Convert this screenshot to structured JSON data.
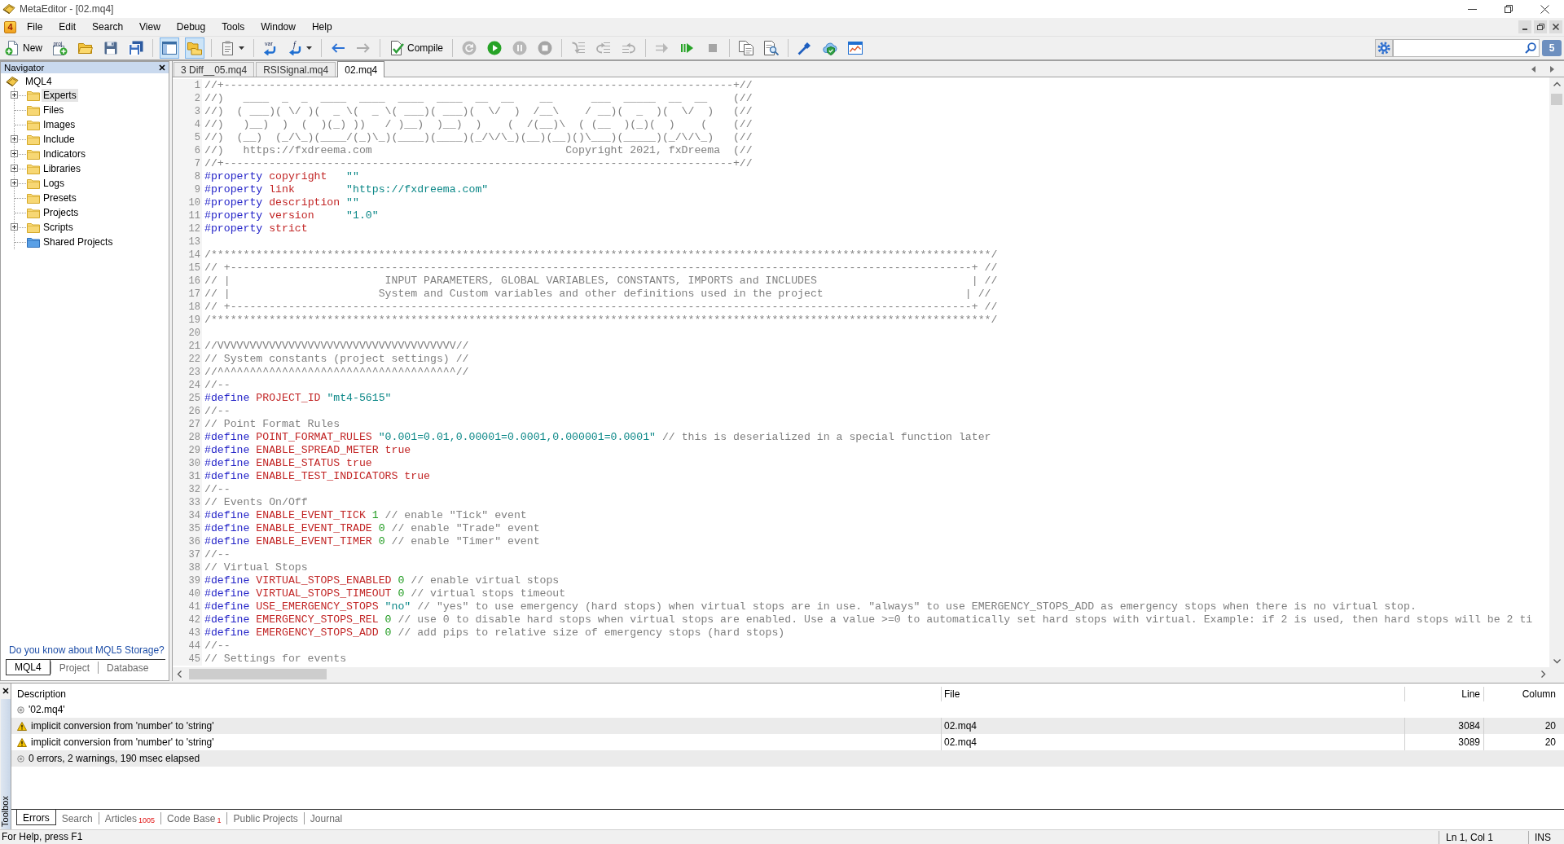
{
  "window": {
    "title": "MetaEditor - [02.mq4]"
  },
  "menu_bar": {
    "badge": "4",
    "items": [
      "File",
      "Edit",
      "Search",
      "View",
      "Debug",
      "Tools",
      "Window",
      "Help"
    ]
  },
  "toolbar": {
    "groups": [
      [
        {
          "label": "New",
          "pressed": false,
          "disabled": false,
          "dropdown": false
        },
        {
          "glyph": "proj",
          "pressed": false,
          "disabled": false,
          "dropdown": false
        },
        {
          "pressed": false,
          "disabled": false,
          "dropdown": false
        },
        {
          "pressed": false,
          "disabled": false,
          "dropdown": false
        },
        {
          "pressed": false,
          "disabled": false,
          "dropdown": false
        }
      ],
      [
        {
          "pressed": true,
          "disabled": false,
          "dropdown": false
        },
        {
          "pressed": true,
          "disabled": false,
          "dropdown": false
        }
      ],
      [
        {
          "pressed": false,
          "disabled": false,
          "dropdown": true
        }
      ],
      [
        {
          "glyph": "var",
          "pressed": false,
          "disabled": false,
          "dropdown": false
        },
        {
          "glyph": "f",
          "pressed": false,
          "disabled": false,
          "dropdown": true
        }
      ],
      [
        {
          "pressed": false,
          "disabled": false,
          "dropdown": false
        },
        {
          "pressed": false,
          "disabled": true,
          "dropdown": false
        }
      ],
      [
        {
          "label": "Compile",
          "pressed": false,
          "disabled": false,
          "dropdown": false
        }
      ],
      [
        {
          "pressed": false,
          "disabled": true,
          "dropdown": false
        },
        {
          "pressed": false,
          "disabled": false,
          "dropdown": false
        },
        {
          "pressed": false,
          "disabled": true,
          "dropdown": false
        },
        {
          "pressed": false,
          "disabled": true,
          "dropdown": false
        }
      ],
      [
        {
          "pressed": false,
          "disabled": true,
          "dropdown": false
        },
        {
          "pressed": false,
          "disabled": true,
          "dropdown": false
        },
        {
          "pressed": false,
          "disabled": true,
          "dropdown": false
        }
      ],
      [
        {
          "pressed": false,
          "disabled": true,
          "dropdown": false
        },
        {
          "pressed": false,
          "disabled": false,
          "dropdown": false
        },
        {
          "pressed": false,
          "disabled": true,
          "dropdown": false
        }
      ],
      [
        {
          "pressed": false,
          "disabled": false,
          "dropdown": false
        },
        {
          "pressed": false,
          "disabled": false,
          "dropdown": false
        }
      ],
      [
        {
          "pressed": false,
          "disabled": false,
          "dropdown": false
        },
        {
          "pressed": false,
          "disabled": false,
          "dropdown": false
        },
        {
          "pressed": false,
          "disabled": false,
          "dropdown": false
        }
      ]
    ],
    "chat_count": "5"
  },
  "navigator": {
    "title": "Navigator",
    "root": {
      "label": "MQL4",
      "selected": false,
      "children": [
        {
          "label": "Experts",
          "kind": "folder",
          "expandable": true,
          "selected": true
        },
        {
          "label": "Files",
          "kind": "folder",
          "expandable": false,
          "selected": false
        },
        {
          "label": "Images",
          "kind": "folder",
          "expandable": false,
          "selected": false
        },
        {
          "label": "Include",
          "kind": "folder",
          "expandable": true,
          "selected": false
        },
        {
          "label": "Indicators",
          "kind": "folder",
          "expandable": true,
          "selected": false
        },
        {
          "label": "Libraries",
          "kind": "folder",
          "expandable": true,
          "selected": false
        },
        {
          "label": "Logs",
          "kind": "folder",
          "expandable": true,
          "selected": false
        },
        {
          "label": "Presets",
          "kind": "folder",
          "expandable": false,
          "selected": false
        },
        {
          "label": "Projects",
          "kind": "folder",
          "expandable": false,
          "selected": false
        },
        {
          "label": "Scripts",
          "kind": "folder",
          "expandable": true,
          "selected": false
        },
        {
          "label": "Shared Projects",
          "kind": "shared",
          "expandable": false,
          "selected": false
        }
      ]
    },
    "storage_link": "Do you know about MQL5 Storage?",
    "tabs": [
      {
        "label": "MQL4",
        "selected": true
      },
      {
        "label": "Project",
        "selected": false
      },
      {
        "label": "Database",
        "selected": false
      }
    ]
  },
  "editor": {
    "tabs": [
      {
        "label": "3 Diff__05.mq4",
        "selected": false
      },
      {
        "label": "RSISignal.mq4",
        "selected": false
      },
      {
        "label": "02.mq4",
        "selected": true
      }
    ],
    "lines": [
      {
        "number": "1",
        "tokens": [
          {
            "kind": "comment",
            "text": "//+-------------------------------------------------------------------------------+//"
          }
        ]
      },
      {
        "number": "2",
        "tokens": [
          {
            "kind": "comment",
            "text": "//)   ____  _  _  ____  ____  ____  ____  __  __    __      ___  _____  __  __    (//"
          }
        ]
      },
      {
        "number": "3",
        "tokens": [
          {
            "kind": "comment",
            "text": "//)  ( ___)( \\/ )(  _ \\(  _ \\( ___)( ___)(  \\/  )  /__\\    / __)(  _  )(  \\/  )   (//"
          }
        ]
      },
      {
        "number": "4",
        "tokens": [
          {
            "kind": "comment",
            "text": "//)   )__)  )  (  )(_) ))   / )__)  )__)  )    (  /(__)\\  ( (__  )(_)(  )    (    (//"
          }
        ]
      },
      {
        "number": "5",
        "tokens": [
          {
            "kind": "comment",
            "text": "//)  (__)  (_/\\_)(____/(_)\\_)(____)(____)(_/\\/\\_)(__)(__)()\\___)(_____)(_/\\/\\_)   (//"
          }
        ]
      },
      {
        "number": "6",
        "tokens": [
          {
            "kind": "comment",
            "text": "//)   https://fxdreema.com                              Copyright 2021, fxDreema  (//"
          }
        ]
      },
      {
        "number": "7",
        "tokens": [
          {
            "kind": "comment",
            "text": "//+-------------------------------------------------------------------------------+//"
          }
        ]
      },
      {
        "number": "8",
        "tokens": [
          {
            "kind": "directive",
            "text": "#property"
          },
          {
            "kind": "name",
            "text": " copyright"
          },
          {
            "kind": "string",
            "text": "   \"\""
          }
        ]
      },
      {
        "number": "9",
        "tokens": [
          {
            "kind": "directive",
            "text": "#property"
          },
          {
            "kind": "name",
            "text": " link"
          },
          {
            "kind": "string",
            "text": "        \"https://fxdreema.com\""
          }
        ]
      },
      {
        "number": "10",
        "tokens": [
          {
            "kind": "directive",
            "text": "#property"
          },
          {
            "kind": "name",
            "text": " description"
          },
          {
            "kind": "string",
            "text": " \"\""
          }
        ]
      },
      {
        "number": "11",
        "tokens": [
          {
            "kind": "directive",
            "text": "#property"
          },
          {
            "kind": "name",
            "text": " version"
          },
          {
            "kind": "string",
            "text": "     \"1.0\""
          }
        ]
      },
      {
        "number": "12",
        "tokens": [
          {
            "kind": "directive",
            "text": "#property"
          },
          {
            "kind": "name",
            "text": " strict"
          }
        ]
      },
      {
        "number": "13"
      },
      {
        "number": "14",
        "tokens": [
          {
            "kind": "comment",
            "text": "/*************************************************************************************************************************/"
          }
        ]
      },
      {
        "number": "15",
        "tokens": [
          {
            "kind": "comment",
            "text": "// +-------------------------------------------------------------------------------------------------------------------+ //"
          }
        ]
      },
      {
        "number": "16",
        "tokens": [
          {
            "kind": "comment",
            "text": "// |                        INPUT PARAMETERS, GLOBAL VARIABLES, CONSTANTS, IMPORTS and INCLUDES                        | //"
          }
        ]
      },
      {
        "number": "17",
        "tokens": [
          {
            "kind": "comment",
            "text": "// |                       System and Custom variables and other definitions used in the project                      | //"
          }
        ]
      },
      {
        "number": "18",
        "tokens": [
          {
            "kind": "comment",
            "text": "// +-------------------------------------------------------------------------------------------------------------------+ //"
          }
        ]
      },
      {
        "number": "19",
        "tokens": [
          {
            "kind": "comment",
            "text": "/*************************************************************************************************************************/"
          }
        ]
      },
      {
        "number": "20"
      },
      {
        "number": "21",
        "tokens": [
          {
            "kind": "comment",
            "text": "//VVVVVVVVVVVVVVVVVVVVVVVVVVVVVVVVVVVVV//"
          }
        ]
      },
      {
        "number": "22",
        "tokens": [
          {
            "kind": "comment",
            "text": "// System constants (project settings) //"
          }
        ]
      },
      {
        "number": "23",
        "tokens": [
          {
            "kind": "comment",
            "text": "//^^^^^^^^^^^^^^^^^^^^^^^^^^^^^^^^^^^^^//"
          }
        ]
      },
      {
        "number": "24",
        "tokens": [
          {
            "kind": "comment",
            "text": "//--"
          }
        ]
      },
      {
        "number": "25",
        "tokens": [
          {
            "kind": "directive",
            "text": "#define"
          },
          {
            "kind": "name",
            "text": " PROJECT_ID"
          },
          {
            "kind": "string",
            "text": " \"mt4-5615\""
          }
        ]
      },
      {
        "number": "26",
        "tokens": [
          {
            "kind": "comment",
            "text": "//--"
          }
        ]
      },
      {
        "number": "27",
        "tokens": [
          {
            "kind": "comment",
            "text": "// Point Format Rules"
          }
        ]
      },
      {
        "number": "28",
        "tokens": [
          {
            "kind": "directive",
            "text": "#define"
          },
          {
            "kind": "name",
            "text": " POINT_FORMAT_RULES"
          },
          {
            "kind": "string",
            "text": " \"0.001=0.01,0.00001=0.0001,0.000001=0.0001\""
          },
          {
            "kind": "comment",
            "text": " // this is deserialized in a special function later"
          }
        ]
      },
      {
        "number": "29",
        "tokens": [
          {
            "kind": "directive",
            "text": "#define"
          },
          {
            "kind": "name",
            "text": " ENABLE_SPREAD_METER"
          },
          {
            "kind": "name",
            "text": " true"
          }
        ]
      },
      {
        "number": "30",
        "tokens": [
          {
            "kind": "directive",
            "text": "#define"
          },
          {
            "kind": "name",
            "text": " ENABLE_STATUS"
          },
          {
            "kind": "name",
            "text": " true"
          }
        ]
      },
      {
        "number": "31",
        "tokens": [
          {
            "kind": "directive",
            "text": "#define"
          },
          {
            "kind": "name",
            "text": " ENABLE_TEST_INDICATORS"
          },
          {
            "kind": "name",
            "text": " true"
          }
        ]
      },
      {
        "number": "32",
        "tokens": [
          {
            "kind": "comment",
            "text": "//--"
          }
        ]
      },
      {
        "number": "33",
        "tokens": [
          {
            "kind": "comment",
            "text": "// Events On/Off"
          }
        ]
      },
      {
        "number": "34",
        "tokens": [
          {
            "kind": "directive",
            "text": "#define"
          },
          {
            "kind": "name",
            "text": " ENABLE_EVENT_TICK"
          },
          {
            "kind": "number",
            "text": " 1"
          },
          {
            "kind": "comment",
            "text": " // enable \"Tick\" event"
          }
        ]
      },
      {
        "number": "35",
        "tokens": [
          {
            "kind": "directive",
            "text": "#define"
          },
          {
            "kind": "name",
            "text": " ENABLE_EVENT_TRADE"
          },
          {
            "kind": "number",
            "text": " 0"
          },
          {
            "kind": "comment",
            "text": " // enable \"Trade\" event"
          }
        ]
      },
      {
        "number": "36",
        "tokens": [
          {
            "kind": "directive",
            "text": "#define"
          },
          {
            "kind": "name",
            "text": " ENABLE_EVENT_TIMER"
          },
          {
            "kind": "number",
            "text": " 0"
          },
          {
            "kind": "comment",
            "text": " // enable \"Timer\" event"
          }
        ]
      },
      {
        "number": "37",
        "tokens": [
          {
            "kind": "comment",
            "text": "//--"
          }
        ]
      },
      {
        "number": "38",
        "tokens": [
          {
            "kind": "comment",
            "text": "// Virtual Stops"
          }
        ]
      },
      {
        "number": "39",
        "tokens": [
          {
            "kind": "directive",
            "text": "#define"
          },
          {
            "kind": "name",
            "text": " VIRTUAL_STOPS_ENABLED"
          },
          {
            "kind": "number",
            "text": " 0"
          },
          {
            "kind": "comment",
            "text": " // enable virtual stops"
          }
        ]
      },
      {
        "number": "40",
        "tokens": [
          {
            "kind": "directive",
            "text": "#define"
          },
          {
            "kind": "name",
            "text": " VIRTUAL_STOPS_TIMEOUT"
          },
          {
            "kind": "number",
            "text": " 0"
          },
          {
            "kind": "comment",
            "text": " // virtual stops timeout"
          }
        ]
      },
      {
        "number": "41",
        "tokens": [
          {
            "kind": "directive",
            "text": "#define"
          },
          {
            "kind": "name",
            "text": " USE_EMERGENCY_STOPS"
          },
          {
            "kind": "string",
            "text": " \"no\""
          },
          {
            "kind": "comment",
            "text": " // \"yes\" to use emergency (hard stops) when virtual stops are in use. \"always\" to use EMERGENCY_STOPS_ADD as emergency stops when there is no virtual stop."
          }
        ]
      },
      {
        "number": "42",
        "tokens": [
          {
            "kind": "directive",
            "text": "#define"
          },
          {
            "kind": "name",
            "text": " EMERGENCY_STOPS_REL"
          },
          {
            "kind": "number",
            "text": " 0"
          },
          {
            "kind": "comment",
            "text": " // use 0 to disable hard stops when virtual stops are enabled. Use a value >=0 to automatically set hard stops with virtual. Example: if 2 is used, then hard stops will be 2 ti"
          }
        ]
      },
      {
        "number": "43",
        "tokens": [
          {
            "kind": "directive",
            "text": "#define"
          },
          {
            "kind": "name",
            "text": " EMERGENCY_STOPS_ADD"
          },
          {
            "kind": "number",
            "text": " 0"
          },
          {
            "kind": "comment",
            "text": " // add pips to relative size of emergency stops (hard stops)"
          }
        ]
      },
      {
        "number": "44",
        "tokens": [
          {
            "kind": "comment",
            "text": "//--"
          }
        ]
      },
      {
        "number": "45",
        "tokens": [
          {
            "kind": "comment",
            "text": "// Settings for events"
          }
        ]
      }
    ]
  },
  "toolbox": {
    "title": "Toolbox",
    "columns": [
      "Description",
      "File",
      "Line",
      "Column"
    ],
    "rows": [
      {
        "kind": "info",
        "description": "'02.mq4'"
      },
      {
        "kind": "warning",
        "description": "implicit conversion from 'number' to 'string'",
        "file": "02.mq4",
        "line": "3084",
        "column": "20"
      },
      {
        "kind": "warning",
        "description": "implicit conversion from 'number' to 'string'",
        "file": "02.mq4",
        "line": "3089",
        "column": "20"
      },
      {
        "kind": "info",
        "description": "0 errors, 2 warnings, 190 msec elapsed"
      }
    ],
    "tabs": [
      {
        "label": "Errors",
        "selected": true
      },
      {
        "label": "Search",
        "selected": false
      },
      {
        "label": "Articles",
        "count": "1005",
        "selected": false
      },
      {
        "label": "Code Base",
        "count": "1",
        "selected": false
      },
      {
        "label": "Public Projects",
        "selected": false
      },
      {
        "label": "Journal",
        "selected": false
      }
    ]
  },
  "status_bar": {
    "help": "For Help, press F1",
    "position": "Ln 1, Col 1",
    "mode": "INS"
  }
}
